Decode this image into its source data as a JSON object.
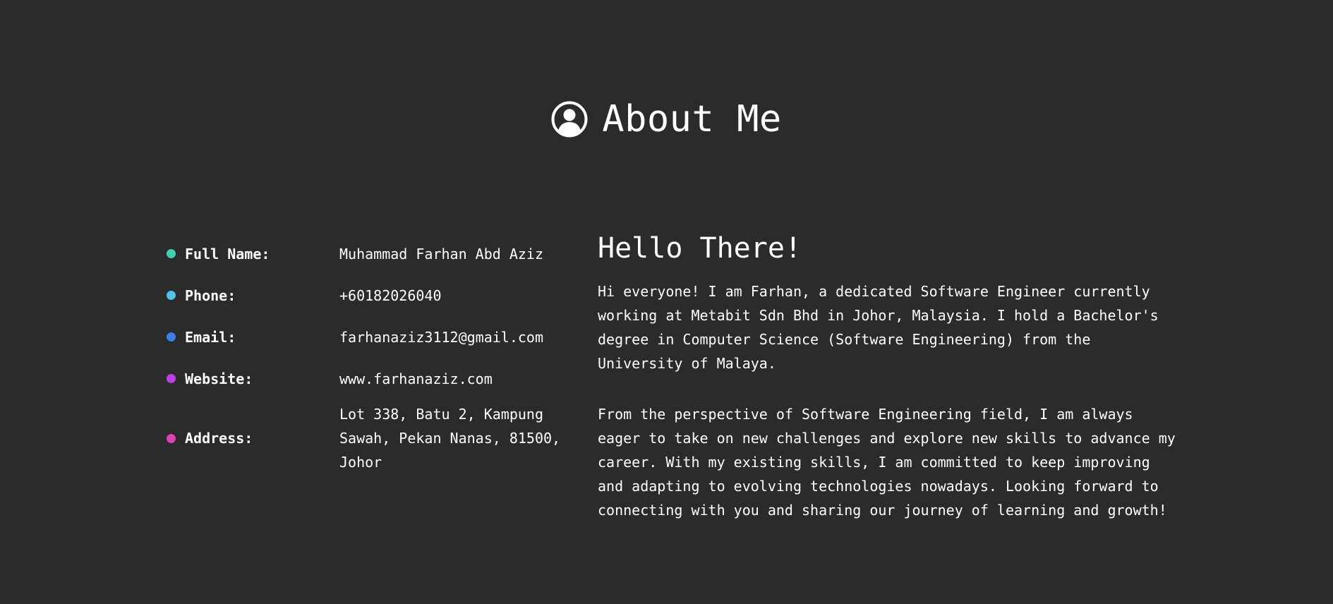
{
  "header": {
    "icon": "user-circle-icon",
    "title": "About Me"
  },
  "info": {
    "items": [
      {
        "label": "Full Name:",
        "value": "Muhammad Farhan Abd Aziz",
        "color": "#3fd0b0"
      },
      {
        "label": "Phone:",
        "value": "+60182026040",
        "color": "#4fc0e8"
      },
      {
        "label": "Email:",
        "value": "farhanaziz3112@gmail.com",
        "color": "#3a7ee8"
      },
      {
        "label": "Website:",
        "value": "www.farhanaziz.com",
        "color": "#c13ee6"
      },
      {
        "label": "Address:",
        "value": "Lot 338, Batu 2, Kampung\nSawah, Pekan Nanas, 81500,\nJohor",
        "color": "#e040b8"
      }
    ]
  },
  "bio": {
    "title": "Hello There!",
    "paragraphs": [
      "Hi everyone! I am Farhan, a dedicated Software Engineer currently working at Metabit Sdn Bhd in Johor, Malaysia. I hold a Bachelor's degree in Computer Science (Software Engineering) from the University of Malaya.",
      "From the perspective of Software Engineering field, I am always eager to take on new challenges and explore new skills to advance my career. With my existing skills, I am committed to keep improving and adapting to evolving technologies nowadays. Looking forward to connecting with you and sharing our journey of learning and growth!"
    ]
  },
  "colors": {
    "background": "#2b2b2b",
    "text": "#ffffff"
  }
}
